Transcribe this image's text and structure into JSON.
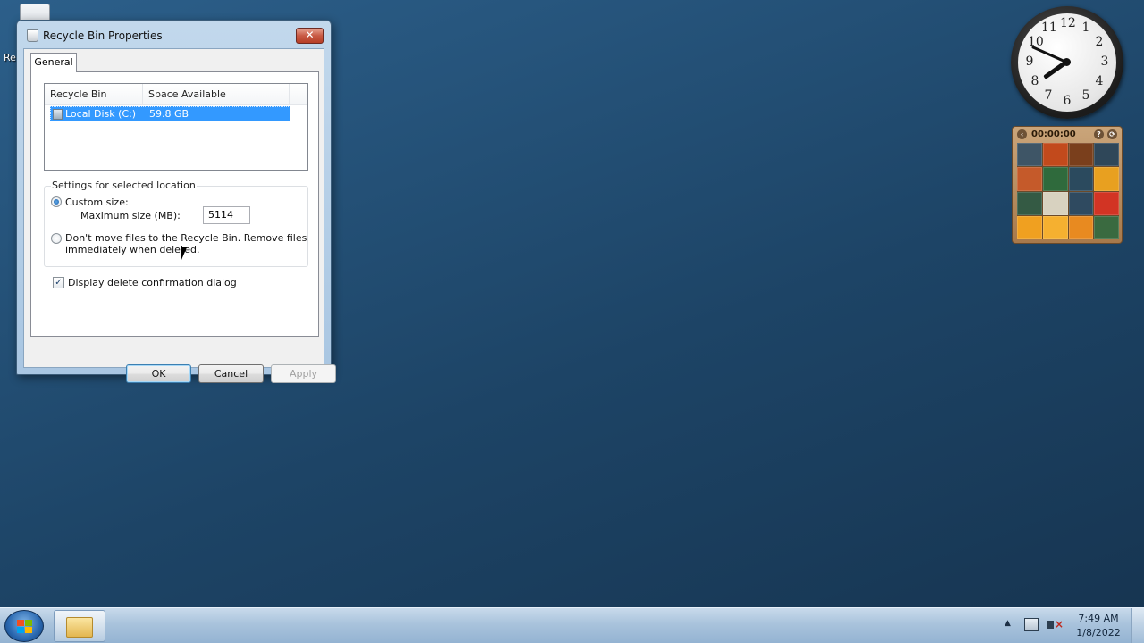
{
  "desktop": {
    "recycle_bin_label": "Re"
  },
  "dialog": {
    "title": "Recycle Bin Properties",
    "close_label": "✕",
    "tab_general": "General",
    "list": {
      "columns": [
        "Recycle Bin Location",
        "Space Available"
      ],
      "rows": [
        {
          "location": "Local Disk (C:)",
          "space": "59.8 GB",
          "selected": true
        }
      ]
    },
    "settings_group_title": "Settings for selected location",
    "custom_size_label": "Custom size:",
    "custom_size_selected": true,
    "max_size_label": "Maximum size (MB):",
    "max_size_value": "5114",
    "dont_move_label_line1": "Don't move files to the Recycle Bin. Remove files",
    "dont_move_label_line2": "immediately when deleted.",
    "dont_move_selected": false,
    "confirm_label": "Display delete confirmation dialog",
    "confirm_checked": true,
    "confirm_check_glyph": "✓",
    "buttons": {
      "ok": "OK",
      "cancel": "Cancel",
      "apply": "Apply"
    },
    "apply_enabled": false
  },
  "clock_gadget": {
    "numbers": [
      "12",
      "1",
      "2",
      "3",
      "4",
      "5",
      "6",
      "7",
      "8",
      "9",
      "10",
      "11"
    ],
    "time": "7:49"
  },
  "puzzle_gadget": {
    "timer": "00:00:00",
    "button_glyphs": {
      "back": "‹",
      "help": "?",
      "close": "⟳"
    },
    "tile_colors": [
      "#3e5566",
      "#c24a1c",
      "#7a3f1c",
      "#2f4759",
      "#c55a2a",
      "#2f6a3c",
      "#2b4a5e",
      "#e8a020",
      "#345a44",
      "#d8d2c0",
      "#2f4a60",
      "#d23424",
      "#f0a020",
      "#f5b030",
      "#e88a20",
      "#3a6a40"
    ]
  },
  "taskbar": {
    "tray_arrow": "▲",
    "time": "7:49 AM",
    "date": "1/8/2022"
  }
}
